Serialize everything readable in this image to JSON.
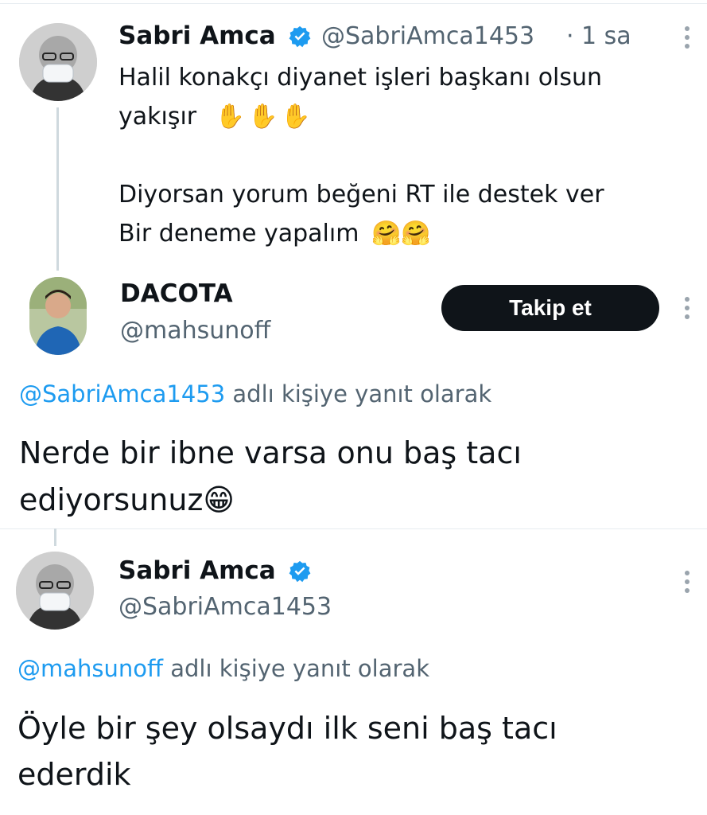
{
  "tweet1": {
    "name": "Sabri Amca",
    "handle": "@SabriAmca1453",
    "sep": "·",
    "time": "1 sa",
    "lines": [
      "Halil konakçı diyanet işleri başkanı olsun",
      "yakışır",
      "",
      "Diyorsan yorum beğeni RT ile destek ver",
      "Bir deneme yapalım"
    ],
    "emoji_line2": "✋✋✋",
    "emoji_line5": "🤗🤗"
  },
  "reply1": {
    "name": "DACOTA",
    "handle": "@mahsunoff",
    "follow_label": "Takip et",
    "replying_mention": "@SabriAmca1453",
    "replying_suffix": " adlı kişiye yanıt olarak",
    "lines": [
      "Nerde bir ibne varsa onu baş tacı",
      "ediyorsunuz"
    ],
    "emoji": "😁"
  },
  "reply2": {
    "name": "Sabri Amca",
    "handle": "@SabriAmca1453",
    "replying_mention": "@mahsunoff",
    "replying_suffix": " adlı kişiye yanıt olarak",
    "lines": [
      "Öyle bir şey olsaydı ilk seni baş tacı",
      "ederdik"
    ]
  },
  "icons": {
    "verified": "verified-badge-icon",
    "more": "more-options-icon"
  },
  "colors": {
    "accent": "#1d9bf0",
    "text": "#0f1419",
    "muted": "#536471",
    "button": "#0f1419"
  }
}
